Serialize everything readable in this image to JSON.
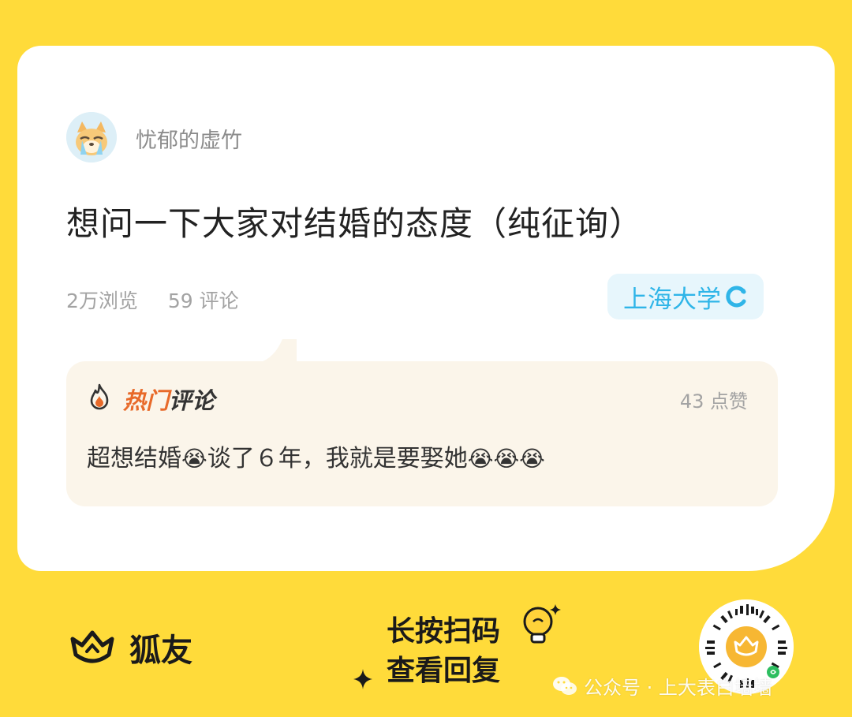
{
  "post": {
    "username": "忧郁的虚竹",
    "title": "想问一下大家对结婚的态度（纯征询）",
    "views": "2万浏览",
    "comments": "59 评论",
    "school": "上海大学"
  },
  "hot_comment": {
    "label_part1": "热门",
    "label_part2": "评论",
    "likes": "43 点赞",
    "text_before": "超想结婚",
    "text_middle": "谈了６年，我就是要娶她",
    "emoji": "😭"
  },
  "footer": {
    "brand_name": "狐友",
    "cta_line1": "长按扫码",
    "cta_line2": "查看回复",
    "watermark": "公众号 · 上大表白墙墙"
  },
  "colors": {
    "background": "#FFDB3A",
    "accent_orange": "#E86A2A",
    "school_blue": "#2FB5E8"
  }
}
